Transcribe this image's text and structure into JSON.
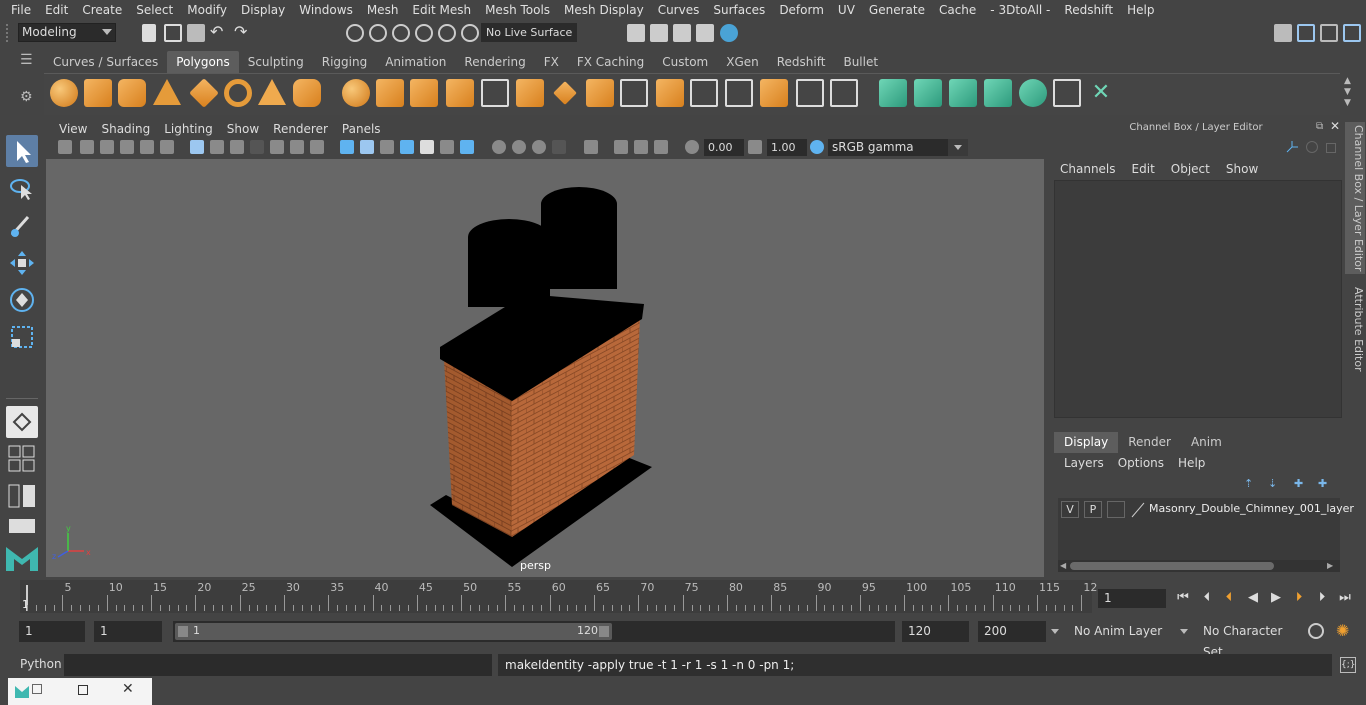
{
  "menubar": [
    "File",
    "Edit",
    "Create",
    "Select",
    "Modify",
    "Display",
    "Windows",
    "Mesh",
    "Edit Mesh",
    "Mesh Tools",
    "Mesh Display",
    "Curves",
    "Surfaces",
    "Deform",
    "UV",
    "Generate",
    "Cache",
    "- 3DtoAll -",
    "Redshift",
    "Help"
  ],
  "statusline": {
    "mode": "Modeling",
    "live_surface": "No Live Surface"
  },
  "shelf": {
    "tabs": [
      "Curves / Surfaces",
      "Polygons",
      "Sculpting",
      "Rigging",
      "Animation",
      "Rendering",
      "FX",
      "FX Caching",
      "Custom",
      "XGen",
      "Redshift",
      "Bullet"
    ],
    "active_tab": "Polygons"
  },
  "viewport": {
    "menu": [
      "View",
      "Shading",
      "Lighting",
      "Show",
      "Renderer",
      "Panels"
    ],
    "exposure": "0.00",
    "gamma": "1.00",
    "color_space": "sRGB gamma",
    "camera_label": "persp"
  },
  "channel_box": {
    "title": "Channel Box / Layer Editor",
    "menu": [
      "Channels",
      "Edit",
      "Object",
      "Show"
    ],
    "side_tabs": [
      "Channel Box / Layer Editor",
      "Attribute Editor"
    ]
  },
  "layer_editor": {
    "tabs": [
      "Display",
      "Render",
      "Anim"
    ],
    "active_tab": "Display",
    "menu": [
      "Layers",
      "Options",
      "Help"
    ],
    "layers": [
      {
        "v": "V",
        "p": "P",
        "name": "Masonry_Double_Chimney_001_layer"
      }
    ]
  },
  "timeline": {
    "ticks": [
      "5",
      "10",
      "15",
      "20",
      "25",
      "30",
      "35",
      "40",
      "45",
      "50",
      "55",
      "60",
      "65",
      "70",
      "75",
      "80",
      "85",
      "90",
      "95",
      "100",
      "105",
      "110",
      "115",
      "12"
    ],
    "start_marker": "1",
    "current_frame": "1"
  },
  "range": {
    "start": "1",
    "start2": "1",
    "slider_start": "1",
    "slider_end": "120",
    "end": "120",
    "end2": "200",
    "anim_layer": "No Anim Layer",
    "character_set": "No Character Set"
  },
  "command_line": {
    "language": "Python",
    "result": "makeIdentity -apply true -t 1 -r 1 -s 1 -n 0 -pn 1;"
  }
}
